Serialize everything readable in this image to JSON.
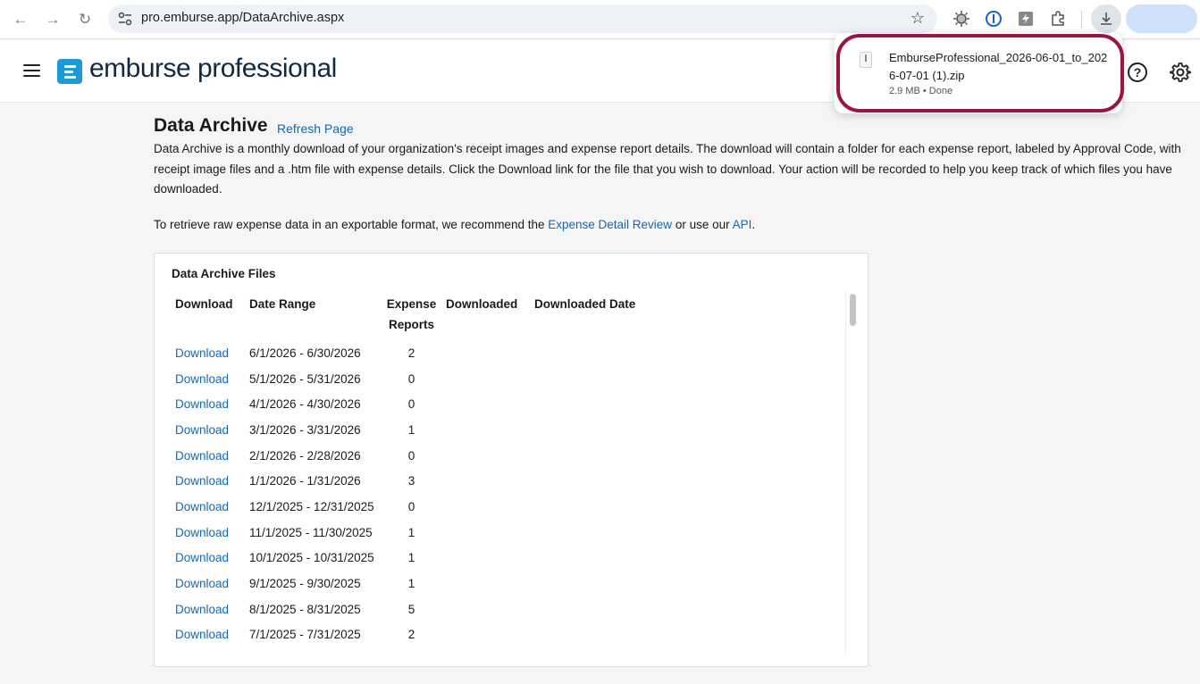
{
  "browser": {
    "url": "pro.emburse.app/DataArchive.aspx"
  },
  "header": {
    "logo_text": "emburse professional"
  },
  "page": {
    "title": "Data Archive",
    "refresh_label": "Refresh Page",
    "intro": "Data Archive is a monthly download of your organization's receipt images and expense report details. The download will contain a folder for each expense report, labeled by Approval Code, with receipt image files and a .htm file with expense details. Click the Download link for the file that you wish to download. Your action will be recorded to help you keep track of which files you have downloaded.",
    "retrieve_prefix": "To retrieve raw expense data in an exportable format, we recommend the ",
    "retrieve_link1": "Expense Detail Review",
    "retrieve_middle": " or use our ",
    "retrieve_link2": "API",
    "retrieve_suffix": "."
  },
  "files_card": {
    "title": "Data Archive Files",
    "columns": {
      "download": "Download",
      "date_range": "Date Range",
      "expense_reports": "Expense Reports",
      "downloaded": "Downloaded",
      "downloaded_date": "Downloaded Date"
    },
    "rows": [
      {
        "link": "Download",
        "range": "6/1/2026 - 6/30/2026",
        "reports": "2"
      },
      {
        "link": "Download",
        "range": "5/1/2026 - 5/31/2026",
        "reports": "0"
      },
      {
        "link": "Download",
        "range": "4/1/2026 - 4/30/2026",
        "reports": "0"
      },
      {
        "link": "Download",
        "range": "3/1/2026 - 3/31/2026",
        "reports": "1"
      },
      {
        "link": "Download",
        "range": "2/1/2026 - 2/28/2026",
        "reports": "0"
      },
      {
        "link": "Download",
        "range": "1/1/2026 - 1/31/2026",
        "reports": "3"
      },
      {
        "link": "Download",
        "range": "12/1/2025 - 12/31/2025",
        "reports": "0"
      },
      {
        "link": "Download",
        "range": "11/1/2025 - 11/30/2025",
        "reports": "1"
      },
      {
        "link": "Download",
        "range": "10/1/2025 - 10/31/2025",
        "reports": "1"
      },
      {
        "link": "Download",
        "range": "9/1/2025 - 9/30/2025",
        "reports": "1"
      },
      {
        "link": "Download",
        "range": "8/1/2025 - 8/31/2025",
        "reports": "5"
      },
      {
        "link": "Download",
        "range": "7/1/2025 - 7/31/2025",
        "reports": "2"
      }
    ]
  },
  "download_bubble": {
    "filename": "EmburseProfessional_2026-06-01_to_2026-07-01 (1).zip",
    "status": "2.9 MB • Done"
  },
  "colors": {
    "link": "#1668b3",
    "brand": "#1d9ad6",
    "highlight": "#9a1545"
  }
}
